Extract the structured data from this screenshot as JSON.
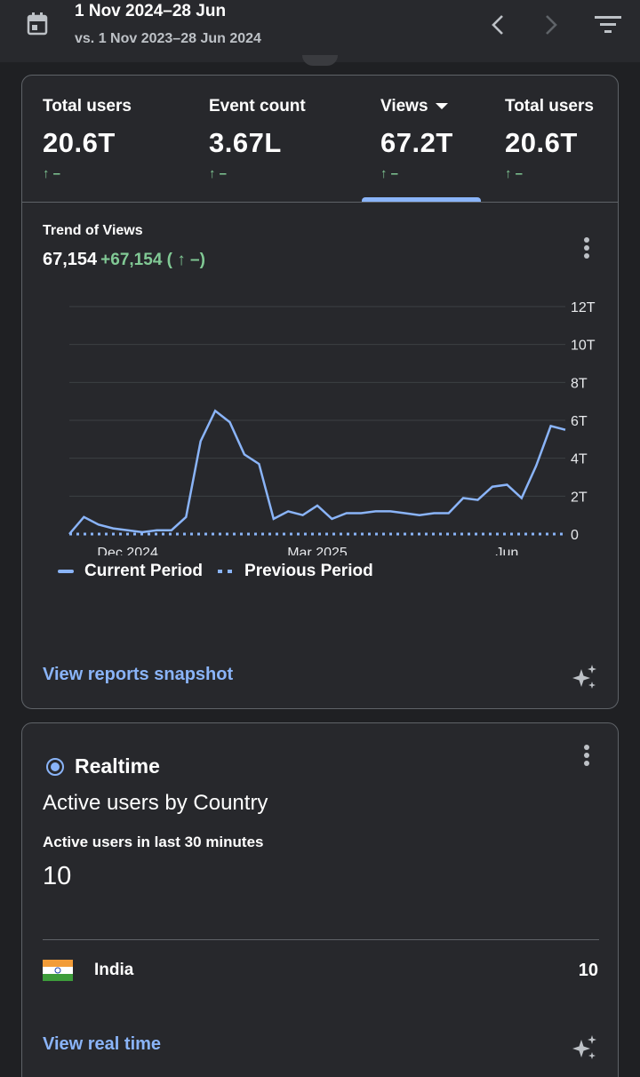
{
  "header": {
    "date_range": "1 Nov 2024–28 Jun",
    "compare_range": "vs. 1 Nov 2023–28 Jun 2024"
  },
  "metrics": [
    {
      "label": "Total users",
      "value": "20.6T",
      "delta": "↑ –"
    },
    {
      "label": "Event count",
      "value": "3.67L",
      "delta": "↑ –"
    },
    {
      "label": "Views",
      "value": "67.2T",
      "delta": "↑ –",
      "selected": true
    },
    {
      "label": "Total users",
      "value": "20.6T",
      "delta": "↑ –"
    }
  ],
  "trend": {
    "title": "Trend of Views",
    "value": "67,154",
    "change": "+67,154 ( ↑ –)"
  },
  "chart_data": {
    "type": "line",
    "x_ticks": [
      "Dec 2024",
      "Mar 2025",
      "Jun"
    ],
    "y_ticks": [
      "0",
      "2T",
      "4T",
      "6T",
      "8T",
      "10T",
      "12T"
    ],
    "ylim": [
      0,
      12
    ],
    "y_unit": "T",
    "grid": true,
    "legend_position": "bottom",
    "series": [
      {
        "name": "Current Period",
        "style": "solid",
        "color": "#8ab4f8",
        "values": [
          0.0,
          0.9,
          0.5,
          0.3,
          0.2,
          0.1,
          0.2,
          0.2,
          0.9,
          4.9,
          6.5,
          5.9,
          4.2,
          3.7,
          0.8,
          1.2,
          1.0,
          1.5,
          0.8,
          1.1,
          1.1,
          1.2,
          1.2,
          1.1,
          1.0,
          1.1,
          1.1,
          1.9,
          1.8,
          2.5,
          2.6,
          1.9,
          3.6,
          5.7,
          5.5
        ]
      },
      {
        "name": "Previous Period",
        "style": "dotted",
        "color": "#8ab4f8",
        "values": [
          0,
          0,
          0,
          0,
          0,
          0,
          0,
          0,
          0,
          0,
          0,
          0,
          0,
          0,
          0,
          0,
          0,
          0,
          0,
          0,
          0,
          0,
          0,
          0,
          0,
          0,
          0,
          0,
          0,
          0,
          0,
          0,
          0,
          0,
          0
        ]
      }
    ]
  },
  "card1": {
    "link": "View reports snapshot"
  },
  "realtime": {
    "title": "Realtime",
    "subtitle": "Active users by Country",
    "label": "Active users in last 30 minutes",
    "value": "10",
    "rows": [
      {
        "country": "India",
        "value": "10"
      }
    ],
    "link": "View real time"
  }
}
